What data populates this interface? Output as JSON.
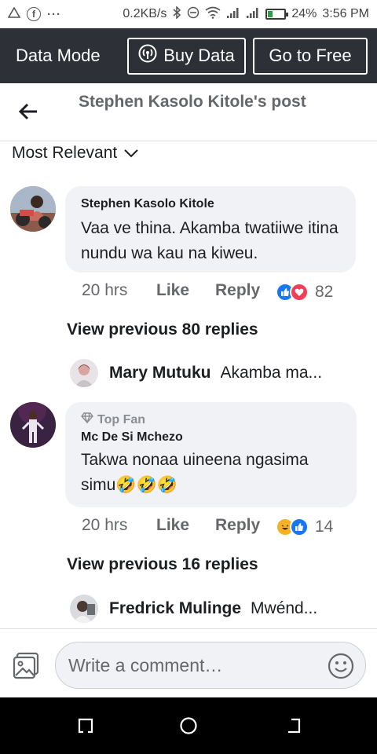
{
  "status_bar": {
    "speed": "0.2KB/s",
    "battery": "24%",
    "battery_level": 0.24,
    "time": "3:56 PM",
    "left_icons": [
      "warning-icon",
      "facebook-icon",
      "more-icon"
    ],
    "right_icons": [
      "bluetooth-icon",
      "dnd-icon",
      "wifi-icon",
      "signal-icon",
      "signal-icon",
      "battery-icon"
    ]
  },
  "data_bar": {
    "mode_label": "Data Mode",
    "buy_label": "Buy Data",
    "free_label": "Go to Free"
  },
  "header": {
    "title": "Stephen Kasolo Kitole's post"
  },
  "sort": {
    "label": "Most Relevant"
  },
  "comments": [
    {
      "author": "Stephen Kasolo Kitole",
      "text": "Vaa ve thina. Akamba twatiiwe itina nundu wa kau na kiweu.",
      "time": "20 hrs",
      "like": "Like",
      "reply": "Reply",
      "reaction_icons": [
        "like-reaction-icon",
        "love-reaction-icon"
      ],
      "reaction_count": "82",
      "view_previous": "View previous 80 replies",
      "reply_preview": {
        "name": "Mary Mutuku",
        "snippet": "Akamba ma..."
      }
    },
    {
      "badge": "Top Fan",
      "author": "Mc De Si Mchezo",
      "text": "Takwa nonaa uineena ngasima simu🤣🤣🤣",
      "time": "20 hrs",
      "like": "Like",
      "reply": "Reply",
      "reaction_icons": [
        "haha-reaction-icon",
        "like-reaction-icon"
      ],
      "reaction_count": "14",
      "view_previous": "View previous 16 replies",
      "reply_preview": {
        "name": "Fredrick Mulinge",
        "snippet": "Mwénd..."
      }
    }
  ],
  "composer": {
    "placeholder": "Write a comment…"
  },
  "colors": {
    "data_bar_bg": "#2d3137",
    "bubble_bg": "#f0f2f5",
    "secondary_text": "#65676b",
    "like_blue": "#1877f2",
    "love_red": "#f33e58",
    "haha_yellow": "#f7b125"
  }
}
